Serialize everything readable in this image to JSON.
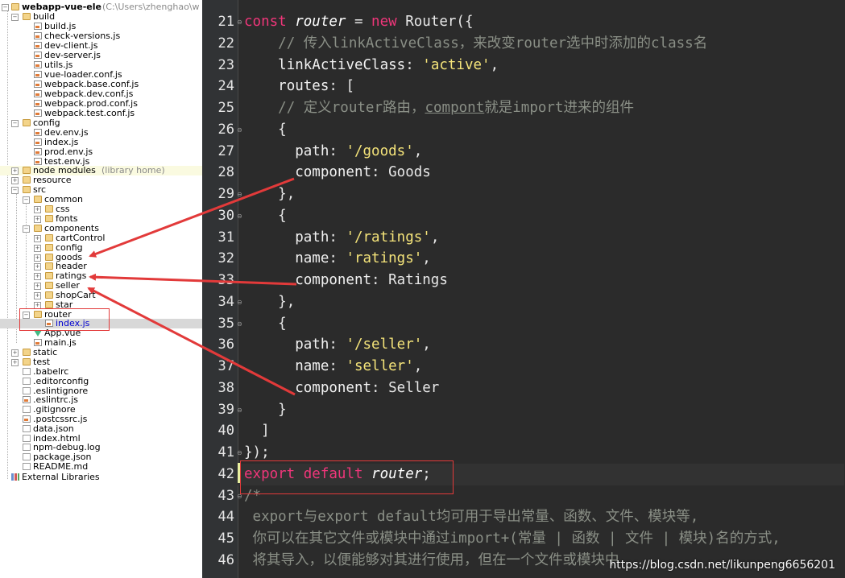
{
  "tree": {
    "root_label": "webapp-vue-ele",
    "root_path": "(C:\\Users\\zhenghao\\w",
    "build_label": "build",
    "build_files": [
      "build.js",
      "check-versions.js",
      "dev-client.js",
      "dev-server.js",
      "utils.js",
      "vue-loader.conf.js",
      "webpack.base.conf.js",
      "webpack.dev.conf.js",
      "webpack.prod.conf.js",
      "webpack.test.conf.js"
    ],
    "config_label": "config",
    "config_files": [
      "dev.env.js",
      "index.js",
      "prod.env.js",
      "test.env.js"
    ],
    "node_modules_label": "node modules",
    "node_modules_hint": "(library home)",
    "resource_label": "resource",
    "src_label": "src",
    "common_label": "common",
    "common_children": [
      "css",
      "fonts"
    ],
    "components_label": "components",
    "components_children": [
      "cartControl",
      "config",
      "goods",
      "header",
      "ratings",
      "seller",
      "shopCart",
      "star"
    ],
    "router_label": "router",
    "router_file": "index.js",
    "app_vue": "App.vue",
    "main_js": "main.js",
    "static_label": "static",
    "test_label": "test",
    "root_files": [
      ".babelrc",
      ".editorconfig",
      ".eslintignore",
      ".eslintrc.js",
      ".gitignore",
      ".postcssrc.js",
      "data.json",
      "index.html",
      "npm-debug.log",
      "package.json",
      "README.md"
    ],
    "external_libraries": "External Libraries"
  },
  "editor": {
    "line_numbers": [
      "21",
      "22",
      "23",
      "24",
      "25",
      "26",
      "27",
      "28",
      "29",
      "30",
      "31",
      "32",
      "33",
      "34",
      "35",
      "36",
      "37",
      "38",
      "39",
      "40",
      "41",
      "42",
      "43",
      "44",
      "45",
      "46"
    ],
    "code": {
      "l21": {
        "kw1": "const ",
        "var": "router",
        "op": " = ",
        "kw2": "new ",
        "rest": "Router({"
      },
      "l22": "// 传入linkActiveClass，来改变router选中时添加的class名",
      "l23": {
        "key": "linkActiveClass",
        "colon": ": ",
        "str": "'active'",
        "tail": ","
      },
      "l24": {
        "key": "routes",
        "tail": ": ["
      },
      "l25": {
        "a": "// 定义router路由，",
        "u": "compont",
        "b": "就是import进来的组件"
      },
      "l26": "{",
      "l27": {
        "key": "path",
        "colon": ": ",
        "str": "'/goods'",
        "tail": ","
      },
      "l28": {
        "key": "component",
        "colon": ": ",
        "val": "Goods"
      },
      "l29": "},",
      "l30": "{",
      "l31": {
        "key": "path",
        "colon": ": ",
        "str": "'/ratings'",
        "tail": ","
      },
      "l32": {
        "key": "name",
        "colon": ": ",
        "str": "'ratings'",
        "tail": ","
      },
      "l33": {
        "key": "component",
        "colon": ": ",
        "val": "Ratings"
      },
      "l34": "},",
      "l35": "{",
      "l36": {
        "key": "path",
        "colon": ": ",
        "str": "'/seller'",
        "tail": ","
      },
      "l37": {
        "key": "name",
        "colon": ": ",
        "str": "'seller'",
        "tail": ","
      },
      "l38": {
        "key": "component",
        "colon": ": ",
        "val": "Seller"
      },
      "l39": "}",
      "l40": "]",
      "l41": "});",
      "l42": {
        "kw1": "export ",
        "kw2": "default ",
        "var": "router",
        "tail": ";"
      },
      "l43": "/*",
      "l44": "export与export default均可用于导出常量、函数、文件、模块等,",
      "l45": "你可以在其它文件或模块中通过import+(常量 | 函数 | 文件 | 模块)名的方式,",
      "l46": "将其导入，以便能够对其进行使用，但在一个文件或模块中"
    },
    "watermark": "https://blog.csdn.net/likunpeng6656201"
  },
  "colors": {
    "keyword": "#f0367a",
    "string": "#f5e47a",
    "comment": "#8a8f86",
    "annotation": "#e23a3a",
    "editor_bg": "#2b2b2b"
  }
}
